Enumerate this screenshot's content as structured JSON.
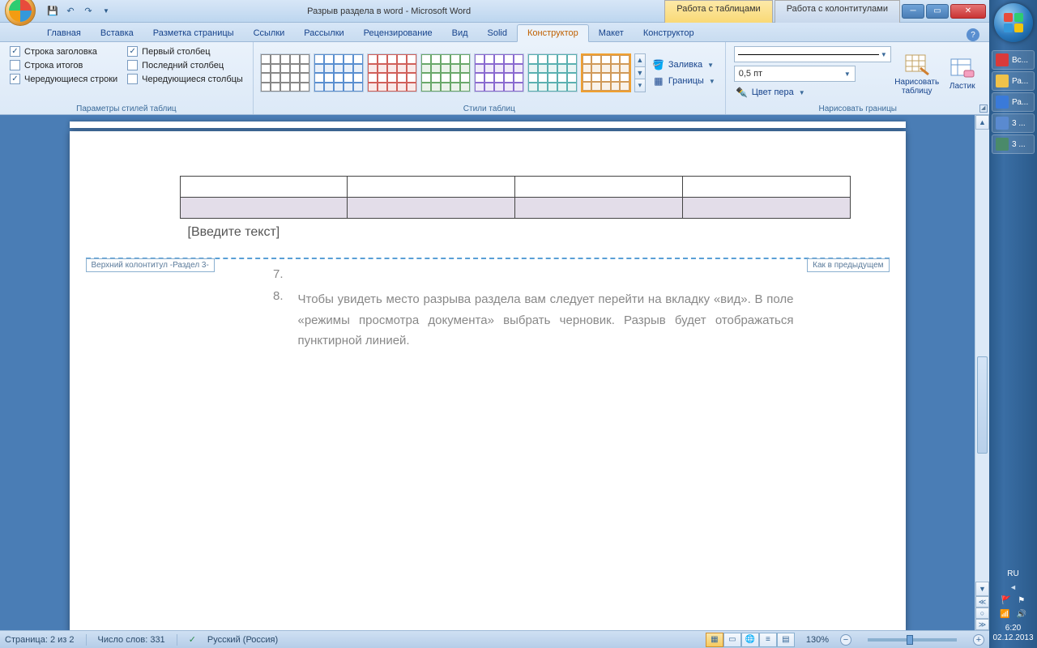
{
  "title": "Разрыв раздела в word - Microsoft Word",
  "context_tabs": {
    "tables": "Работа с таблицами",
    "headers": "Работа с колонтитулами"
  },
  "tabs": [
    "Главная",
    "Вставка",
    "Разметка страницы",
    "Ссылки",
    "Рассылки",
    "Рецензирование",
    "Вид",
    "Solid",
    "Конструктор",
    "Макет",
    "Конструктор"
  ],
  "active_tab_index": 8,
  "groups": {
    "tsopt": {
      "label": "Параметры стилей таблиц",
      "left": [
        {
          "label": "Строка заголовка",
          "checked": true
        },
        {
          "label": "Строка итогов",
          "checked": false
        },
        {
          "label": "Чередующиеся строки",
          "checked": true
        }
      ],
      "right": [
        {
          "label": "Первый столбец",
          "checked": true
        },
        {
          "label": "Последний столбец",
          "checked": false
        },
        {
          "label": "Чередующиеся столбцы",
          "checked": false
        }
      ]
    },
    "tstyles": {
      "label": "Стили таблиц",
      "shading": "Заливка",
      "borders": "Границы"
    },
    "drawb": {
      "label": "Нарисовать границы",
      "weight": "0,5 пт",
      "pen": "Цвет пера",
      "draw": "Нарисовать таблицу",
      "eraser": "Ластик"
    }
  },
  "document": {
    "placeholder": "[Введите текст]",
    "hf_left": "Верхний колонтитул -Раздел 3-",
    "hf_right": "Как в предыдущем",
    "items": [
      {
        "num": "7.",
        "text": ""
      },
      {
        "num": "8.",
        "text": "Чтобы увидеть место разрыва раздела вам следует перейти на вкладку «вид». В поле «режимы просмотра документа» выбрать черновик. Разрыв будет отображаться пунктирной линией."
      }
    ]
  },
  "status": {
    "page": "Страница: 2 из 2",
    "words": "Число слов: 331",
    "lang": "Русский (Россия)",
    "zoom": "130%"
  },
  "taskbar": {
    "items": [
      {
        "label": "Вс...",
        "color": "#d93a3a"
      },
      {
        "label": "Ра...",
        "color": "#f0c24a"
      },
      {
        "label": "Ра...",
        "color": "#3a7ad9"
      },
      {
        "label": "3 ...",
        "color": "#5a8ad0"
      },
      {
        "label": "3 ...",
        "color": "#4a8a6a"
      }
    ],
    "lang": "RU",
    "time": "6:20",
    "date": "02.12.2013"
  }
}
